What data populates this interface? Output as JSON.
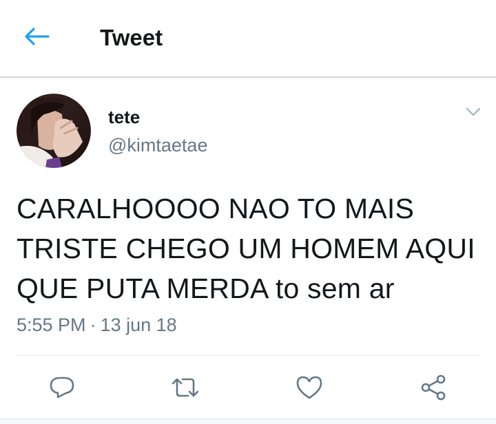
{
  "header": {
    "title": "Tweet",
    "back_icon": "arrow-left-icon"
  },
  "colors": {
    "accent": "#1da1f2",
    "text_primary": "#14171a",
    "text_secondary": "#657786",
    "divider": "#e1e8ed",
    "icon_gray": "#657786"
  },
  "tweet": {
    "author": {
      "display_name": "tete",
      "handle": "@kimtaetae"
    },
    "text_lines": [
      "CARALHOOOO NAO TO MAIS",
      "TRISTE CHEGO UM HOMEM AQUI",
      "QUE PUTA MERDA to sem ar"
    ],
    "time": "5:55 PM",
    "separator": "·",
    "date": "13 jun 18"
  },
  "actions": [
    {
      "name": "reply",
      "icon": "reply-icon"
    },
    {
      "name": "retweet",
      "icon": "retweet-icon"
    },
    {
      "name": "like",
      "icon": "heart-icon"
    },
    {
      "name": "share",
      "icon": "share-icon"
    }
  ]
}
